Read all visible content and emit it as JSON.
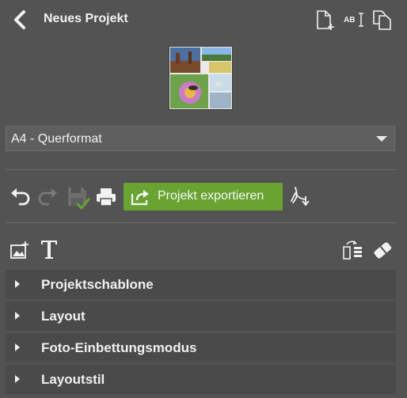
{
  "header": {
    "title": "Neues Projekt",
    "back_icon": "back-chevron",
    "actions": [
      "new-page-icon",
      "ocr-text-icon",
      "duplicate-page-icon"
    ]
  },
  "format_select": {
    "value": "A4 - Querformat"
  },
  "toolbar": {
    "export_label": "Projekt exportieren",
    "export_color": "#6aa331",
    "icons": [
      "undo-icon",
      "redo-icon",
      "save-icon",
      "print-icon",
      "pdf-export-icon"
    ]
  },
  "tools": {
    "icons": [
      "add-image-icon",
      "add-text-icon",
      "swap-layout-icon",
      "eraser-icon"
    ]
  },
  "sections": [
    {
      "label": "Projektschablone"
    },
    {
      "label": "Layout"
    },
    {
      "label": "Foto-Einbettungsmodus"
    },
    {
      "label": "Layoutstil"
    }
  ],
  "colors": {
    "background": "#535353",
    "section_background": "#4a4a4a",
    "accent_green": "#6aa331"
  }
}
